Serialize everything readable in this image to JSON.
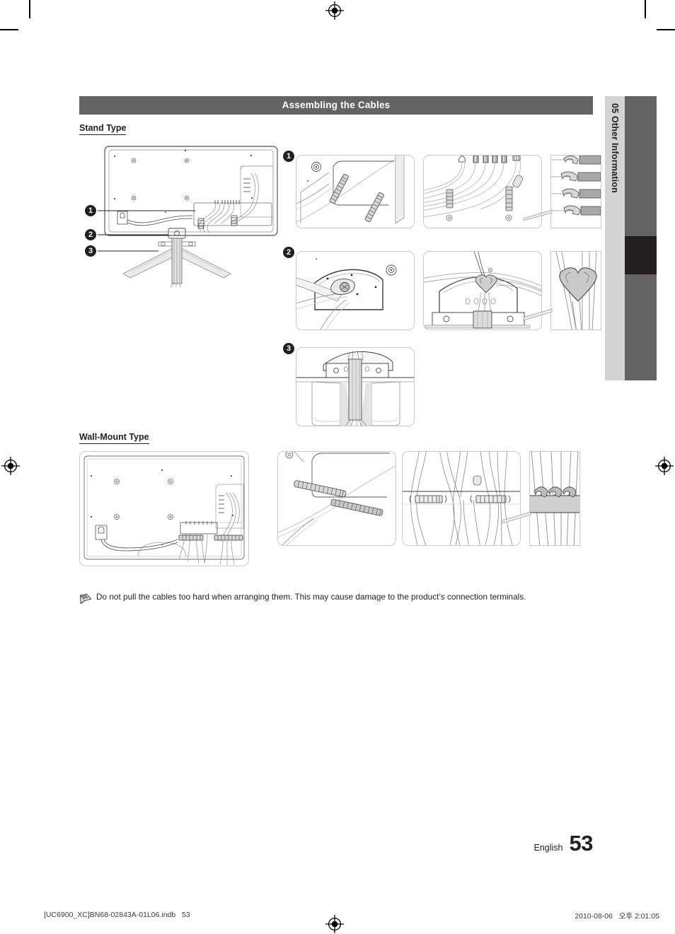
{
  "page": {
    "section_header": "Assembling the Cables",
    "subsections": [
      {
        "title": "Stand Type"
      },
      {
        "title": "Wall-Mount Type"
      }
    ],
    "note": {
      "icon": "pencil-note-icon",
      "text": "Do not pull the cables too hard when arranging them. This may cause damage to the product’s connection terminals."
    },
    "callouts": [
      {
        "number": "1"
      },
      {
        "number": "2"
      },
      {
        "number": "3"
      }
    ],
    "side_tab": {
      "chapter_number": "05",
      "chapter_title": "Other Information",
      "label": "05  Other Information",
      "strip_color": "#d3d3d3",
      "bar_color": "#636363",
      "active_color": "#231f20"
    },
    "footer": {
      "language": "English",
      "page_number": "53"
    },
    "print_footer": {
      "file": "[UC6900_XC]BN68-02843A-01L06.indb   53",
      "timestamp": "2010-08-06   오후 2:01:05"
    },
    "colors": {
      "header_bg": "#636363",
      "header_text": "#ffffff",
      "body_text": "#231f20",
      "panel_border": "#c9c9c9",
      "line_art": "#231f20",
      "shade": "#d8d8d8"
    },
    "marks": {
      "registration": "registration-target-mark",
      "crop": "crop-mark"
    }
  }
}
